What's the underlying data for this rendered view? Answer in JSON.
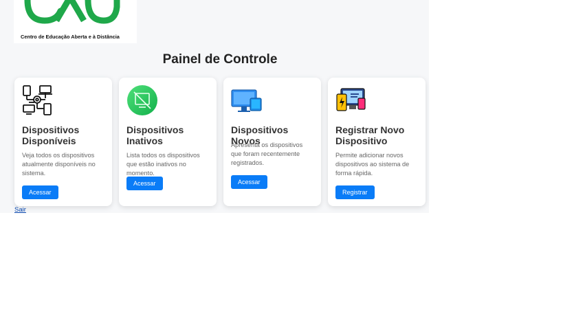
{
  "logo": {
    "caption": "Centro de Educação Aberta e à Distância",
    "brand_color": "#1fa84a"
  },
  "header": {
    "title": "Painel de Controle"
  },
  "cards": [
    {
      "icon": "network-devices-icon",
      "title": "Dispositivos Disponíveis",
      "description": "Veja todos os dispositivos atualmente disponíveis no sistema.",
      "button_label": "Acessar"
    },
    {
      "icon": "inactive-device-icon",
      "title": "Dispositivos Inativos",
      "description": "Lista todos os dispositivos que estão inativos no momento.",
      "button_label": "Acessar"
    },
    {
      "icon": "computer-phone-icon",
      "title": "Dispositivos Novos",
      "description": "Apresenta os dispositivos que foram recentemente registrados.",
      "button_label": "Acessar"
    },
    {
      "icon": "register-device-icon",
      "title": "Registrar Novo Dispositivo",
      "description": "Permite adicionar novos dispositivos ao sistema de forma rápida.",
      "button_label": "Registrar"
    }
  ],
  "footer": {
    "logout_label": "Sair"
  },
  "colors": {
    "accent": "#0a7cf7",
    "background": "#f6f7f9",
    "card": "#ffffff"
  }
}
